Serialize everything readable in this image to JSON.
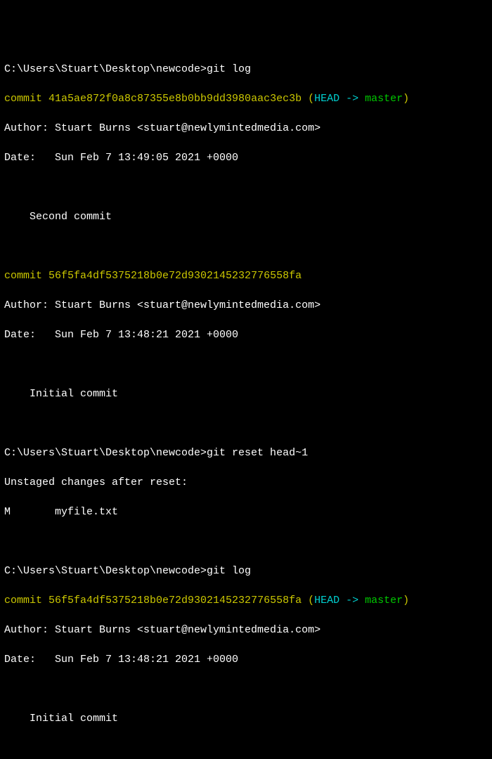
{
  "block1": {
    "prompt_path": "C:\\Users\\Stuart\\Desktop\\newcode>",
    "command": "git log",
    "commit_prefix": "commit ",
    "commit_hash": "41a5ae872f0a8c87355e8b0bb9dd3980aac3ec3b",
    "ref_open": " (",
    "ref_head": "HEAD -> ",
    "ref_branch": "master",
    "ref_close": ")",
    "author": "Author: Stuart Burns <stuart@newlymintedmedia.com>",
    "date": "Date:   Sun Feb 7 13:49:05 2021 +0000",
    "message": "    Second commit"
  },
  "block2": {
    "commit_prefix": "commit ",
    "commit_hash": "56f5fa4df5375218b0e72d9302145232776558fa",
    "author": "Author: Stuart Burns <stuart@newlymintedmedia.com>",
    "date": "Date:   Sun Feb 7 13:48:21 2021 +0000",
    "message": "    Initial commit"
  },
  "block3": {
    "prompt_path": "C:\\Users\\Stuart\\Desktop\\newcode>",
    "command": "git reset head~1",
    "out1": "Unstaged changes after reset:",
    "out2": "M       myfile.txt"
  },
  "block4": {
    "prompt_path": "C:\\Users\\Stuart\\Desktop\\newcode>",
    "command": "git log",
    "commit_prefix": "commit ",
    "commit_hash": "56f5fa4df5375218b0e72d9302145232776558fa",
    "ref_open": " (",
    "ref_head": "HEAD -> ",
    "ref_branch": "master",
    "ref_close": ")",
    "author": "Author: Stuart Burns <stuart@newlymintedmedia.com>",
    "date": "Date:   Sun Feb 7 13:48:21 2021 +0000",
    "message": "    Initial commit"
  }
}
